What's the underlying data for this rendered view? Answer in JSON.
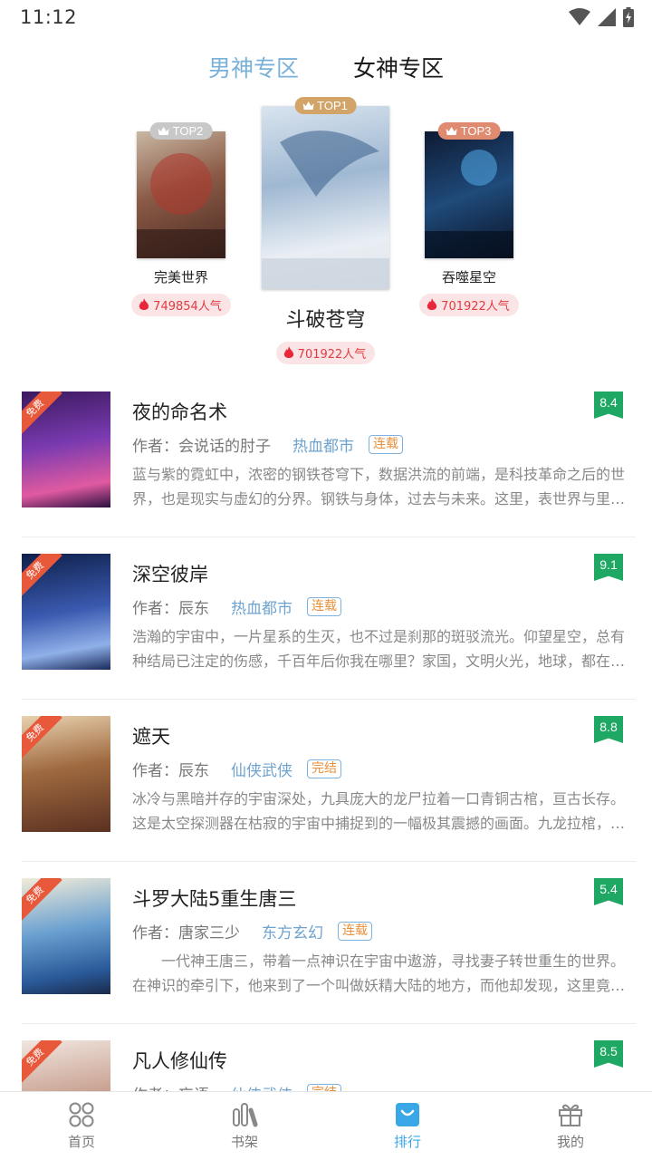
{
  "status_bar": {
    "time": "11:12"
  },
  "tabs": [
    {
      "label": "男神专区",
      "active": true
    },
    {
      "label": "女神专区",
      "active": false
    }
  ],
  "podium": [
    {
      "rank": "TOP2",
      "title": "完美世界",
      "popularity": "749854人气",
      "badge_color": "#c8c8c8"
    },
    {
      "rank": "TOP1",
      "title": "斗破苍穹",
      "popularity": "701922人气",
      "badge_color": "#d2a468"
    },
    {
      "rank": "TOP3",
      "title": "吞噬星空",
      "popularity": "701922人气",
      "badge_color": "#e08a70"
    }
  ],
  "books": [
    {
      "title": "夜的命名术",
      "author": "作者：会说话的肘子",
      "genre": "热血都市",
      "status": "连载",
      "score": "8.4",
      "tag": "免费",
      "desc": "蓝与紫的霓虹中，浓密的钢铁苍穹下，数据洪流的前端，是科技革命之后的世界，也是现实与虚幻的分界。钢铁与身体，过去与未来。这里，表世界与里世界并存。"
    },
    {
      "title": "深空彼岸",
      "author": "作者：辰东",
      "genre": "热血都市",
      "status": "连载",
      "score": "9.1",
      "tag": "免费",
      "desc": " 浩瀚的宇宙中，一片星系的生灭，也不过是刹那的斑驳流光。仰望星空，总有种结局已注定的伤感，千百年后你我在哪里？家国，文明火光，地球，都在深空中."
    },
    {
      "title": "遮天",
      "author": "作者：辰东",
      "genre": "仙侠武侠",
      "status": "完结",
      "score": "8.8",
      "tag": "免费",
      "desc": "冰冷与黑暗并存的宇宙深处，九具庞大的龙尸拉着一口青铜古棺，亘古长存。这是太空探测器在枯寂的宇宙中捕捉到的一幅极其震撼的画面。九龙拉棺，究竟是."
    },
    {
      "title": "斗罗大陆5重生唐三",
      "author": "作者：唐家三少",
      "genre": "东方玄幻",
      "status": "连载",
      "score": "5.4",
      "tag": "免费",
      "desc": "　　一代神王唐三，带着一点神识在宇宙中遨游，寻找妻子转世重生的世界。在神识的牵引下，他来到了一个叫做妖精大陆的地方，而他却发现，这里竟然是."
    },
    {
      "title": "凡人修仙传",
      "author": "作者：忘语",
      "genre": "仙侠武侠",
      "status": "完结",
      "score": "8.5",
      "tag": "免费",
      "desc": ""
    }
  ],
  "nav": [
    {
      "label": "首页",
      "icon": "home-grid-icon",
      "active": false
    },
    {
      "label": "书架",
      "icon": "bookshelf-icon",
      "active": false
    },
    {
      "label": "排行",
      "icon": "ranking-bag-icon",
      "active": true
    },
    {
      "label": "我的",
      "icon": "gift-icon",
      "active": false
    }
  ]
}
